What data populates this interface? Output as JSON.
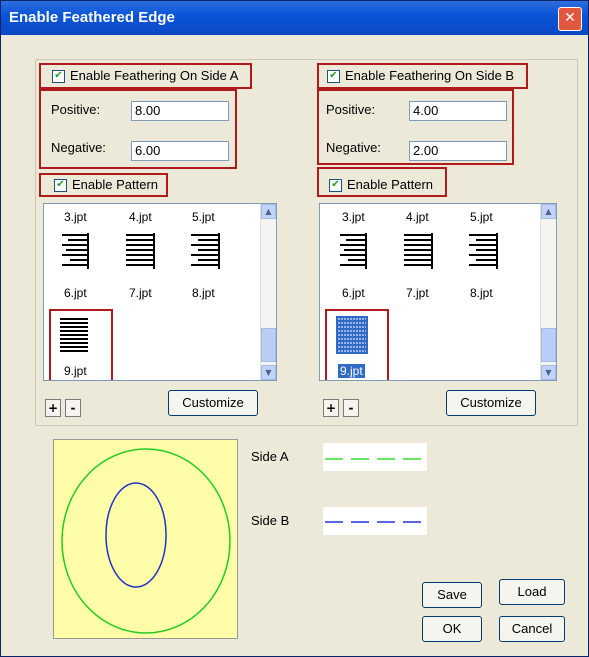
{
  "window": {
    "title": "Enable Feathered Edge"
  },
  "sideA": {
    "enable_label": "Enable Feathering On Side A",
    "enable_checked": true,
    "positive_label": "Positive:",
    "positive_value": "8.00",
    "negative_label": "Negative:",
    "negative_value": "6.00",
    "pattern_label": "Enable Pattern",
    "pattern_checked": true,
    "patterns": [
      "3.jpt",
      "4.jpt",
      "5.jpt",
      "6.jpt",
      "7.jpt",
      "8.jpt",
      "9.jpt"
    ],
    "selected_pattern": "9.jpt",
    "customize_label": "Customize",
    "plus_label": "+",
    "minus_label": "-"
  },
  "sideB": {
    "enable_label": "Enable Feathering On Side B",
    "enable_checked": true,
    "positive_label": "Positive:",
    "positive_value": "4.00",
    "negative_label": "Negative:",
    "negative_value": "2.00",
    "pattern_label": "Enable Pattern",
    "pattern_checked": true,
    "patterns": [
      "3.jpt",
      "4.jpt",
      "5.jpt",
      "6.jpt",
      "7.jpt",
      "8.jpt",
      "9.jpt"
    ],
    "selected_pattern": "9.jpt",
    "customize_label": "Customize",
    "plus_label": "+",
    "minus_label": "-"
  },
  "legend": {
    "sideA_label": "Side A",
    "sideA_color": "#33dd33",
    "sideB_label": "Side B",
    "sideB_color": "#2233dd"
  },
  "preview": {
    "outer_color": "#22cc22",
    "inner_color": "#2233cc",
    "background": "#fffda8"
  },
  "buttons": {
    "save": "Save",
    "load": "Load",
    "ok": "OK",
    "cancel": "Cancel"
  },
  "icons": {
    "close": "close-icon",
    "check": "checkmark-icon",
    "scroll_up": "chevron-up-icon",
    "scroll_down": "chevron-down-icon"
  }
}
